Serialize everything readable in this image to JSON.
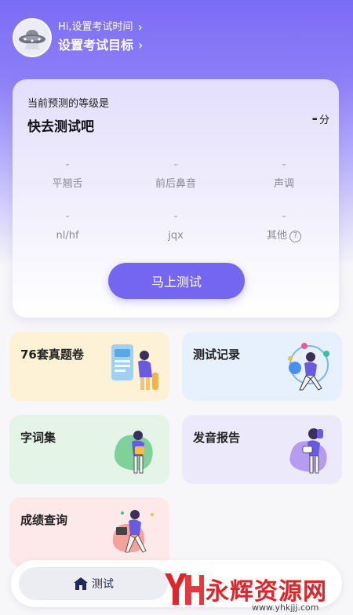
{
  "header": {
    "greeting": "Hi,设置考试时间",
    "goal": "设置考试目标"
  },
  "level_card": {
    "label": "当前预测的等级是",
    "title": "快去测试吧",
    "score_value": "-",
    "score_unit": "分",
    "metrics": [
      {
        "value": "-",
        "label": "平翘舌"
      },
      {
        "value": "-",
        "label": "前后鼻音"
      },
      {
        "value": "-",
        "label": "声调"
      },
      {
        "value": "-",
        "label": "nl/hf"
      },
      {
        "value": "-",
        "label": "jqx"
      },
      {
        "value": "-",
        "label": "其他"
      }
    ],
    "button_label": "马上测试"
  },
  "tiles": [
    {
      "title": "76套真题卷",
      "bg": "#fdf1d6"
    },
    {
      "title": "测试记录",
      "bg": "#e6f1fd"
    },
    {
      "title": "字词集",
      "bg": "#e4f4e7"
    },
    {
      "title": "发音报告",
      "bg": "#ece9fb"
    },
    {
      "title": "成绩查询",
      "bg": "#fde8ea"
    }
  ],
  "tabbar": {
    "active_tab": "测试"
  },
  "watermark": {
    "logo": "YH",
    "text": "永辉资源网",
    "url": "www.yhkjjj.com"
  },
  "colors": {
    "accent": "#7566f2",
    "hero": "#7b6cf6",
    "watermark": "#e0242a"
  }
}
